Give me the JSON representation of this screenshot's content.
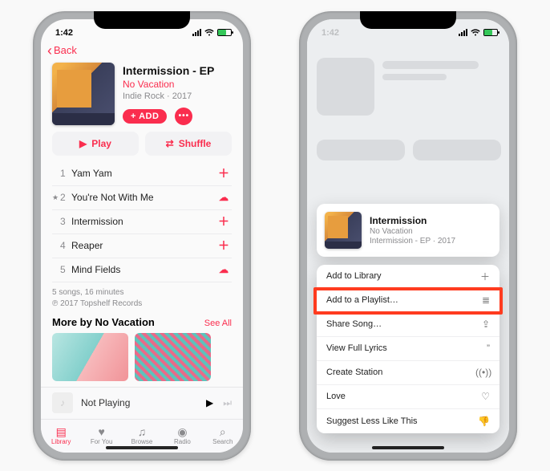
{
  "colors": {
    "accent": "#fa2d4e",
    "highlight": "#ff3b1f"
  },
  "status": {
    "time": "1:42",
    "signal_icon": "signal-icon",
    "wifi_icon": "wifi-icon",
    "battery_icon": "battery-icon"
  },
  "nav": {
    "back_label": "Back"
  },
  "album": {
    "title": "Intermission - EP",
    "artist": "No Vacation",
    "genre_year": "Indie Rock · 2017",
    "add_label": "+ ADD",
    "more_label": "•••"
  },
  "actions": {
    "play": {
      "icon": "play-icon",
      "label": "Play"
    },
    "shuffle": {
      "icon": "shuffle-icon",
      "label": "Shuffle"
    }
  },
  "tracks": [
    {
      "num": "1",
      "starred": false,
      "name": "Yam Yam",
      "action_icon": "plus-icon"
    },
    {
      "num": "2",
      "starred": true,
      "name": "You're Not With Me",
      "action_icon": "cloud-download-icon"
    },
    {
      "num": "3",
      "starred": false,
      "name": "Intermission",
      "action_icon": "plus-icon"
    },
    {
      "num": "4",
      "starred": false,
      "name": "Reaper",
      "action_icon": "plus-icon"
    },
    {
      "num": "5",
      "starred": false,
      "name": "Mind Fields",
      "action_icon": "cloud-download-icon"
    }
  ],
  "tracks_footer": {
    "line1": "5 songs, 16 minutes",
    "line2": "℗ 2017 Topshelf Records"
  },
  "more_by": {
    "heading": "More by No Vacation",
    "see_all": "See All"
  },
  "now_playing": {
    "label": "Not Playing",
    "play_icon": "play-icon",
    "forward_icon": "forward-icon"
  },
  "tabs": [
    {
      "id": "library",
      "label": "Library",
      "icon": "library-icon",
      "active": true
    },
    {
      "id": "for-you",
      "label": "For You",
      "icon": "heart-icon",
      "active": false
    },
    {
      "id": "browse",
      "label": "Browse",
      "icon": "note-icon",
      "active": false
    },
    {
      "id": "radio",
      "label": "Radio",
      "icon": "radio-icon",
      "active": false
    },
    {
      "id": "search",
      "label": "Search",
      "icon": "search-icon",
      "active": false
    }
  ],
  "context_preview": {
    "title": "Intermission",
    "subtitle1": "No Vacation",
    "subtitle2": "Intermission - EP · 2017"
  },
  "context_menu": [
    {
      "label": "Add to Library",
      "icon": "plus-icon",
      "highlighted": false
    },
    {
      "label": "Add to a Playlist…",
      "icon": "playlist-icon",
      "highlighted": true
    },
    {
      "label": "Share Song…",
      "icon": "share-icon",
      "highlighted": false
    },
    {
      "label": "View Full Lyrics",
      "icon": "lyrics-icon",
      "highlighted": false
    },
    {
      "label": "Create Station",
      "icon": "station-icon",
      "highlighted": false
    },
    {
      "label": "Love",
      "icon": "heart-outline-icon",
      "highlighted": false
    },
    {
      "label": "Suggest Less Like This",
      "icon": "dislike-icon",
      "highlighted": false
    }
  ]
}
